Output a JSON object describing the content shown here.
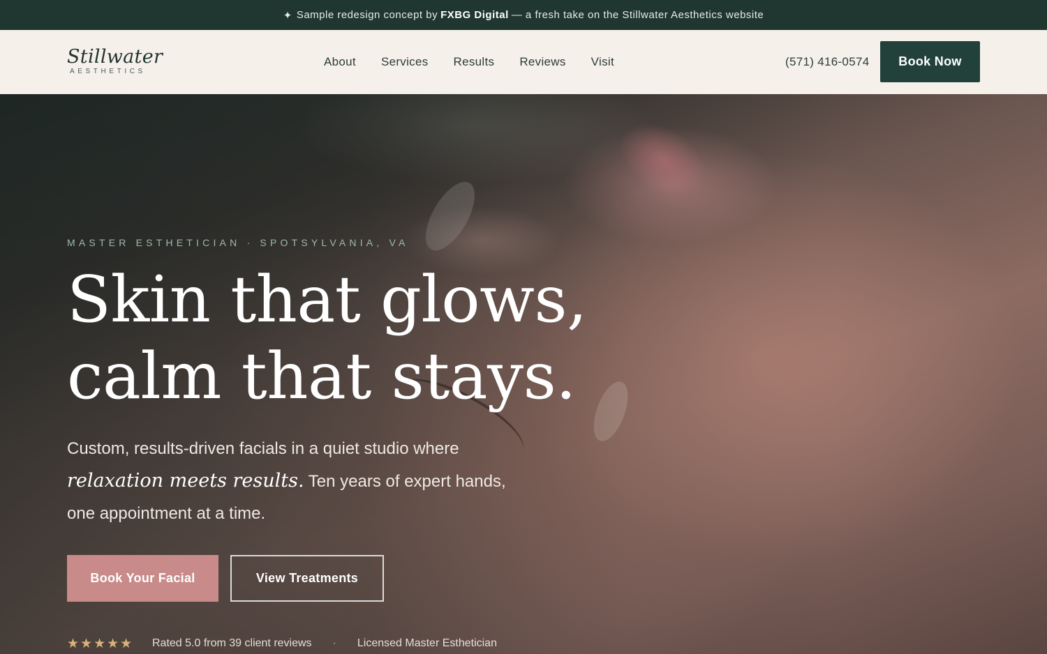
{
  "announcement": {
    "icon": "sparkle-icon",
    "prefix": "Sample redesign concept by",
    "brand": "FXBG Digital",
    "suffix": "— a fresh take on the Stillwater Aesthetics website"
  },
  "nav": {
    "logo": {
      "script": "Stillwater",
      "sub": "AESTHETICS"
    },
    "links": [
      "About",
      "Services",
      "Results",
      "Reviews",
      "Visit"
    ],
    "phone": "(571) 416-0574",
    "cta": "Book Now"
  },
  "hero": {
    "eyebrow": "MASTER ESTHETICIAN · SPOTSYLVANIA, VA",
    "headline_line1": "Skin that glows,",
    "headline_line2": "calm that stays.",
    "lede_start": "Custom, results-driven facials in a quiet studio where",
    "lede_emphasis": "relaxation meets results.",
    "lede_end": "Ten years of expert hands, one appointment at a time.",
    "primary_cta": "Book Your Facial",
    "secondary_cta": "View Treatments",
    "rating_stars": "★★★★★",
    "rating_value": 5,
    "rating_text": "Rated 5.0 from 39 client reviews",
    "separator": "·",
    "credential": "Licensed Master Esthetician"
  },
  "colors": {
    "announcement_bg": "#1f3631",
    "nav_bg": "#f6f0ea",
    "brand_green": "#22413b",
    "rose_accent": "#c98b8a",
    "star_gold": "#d9b27a"
  }
}
